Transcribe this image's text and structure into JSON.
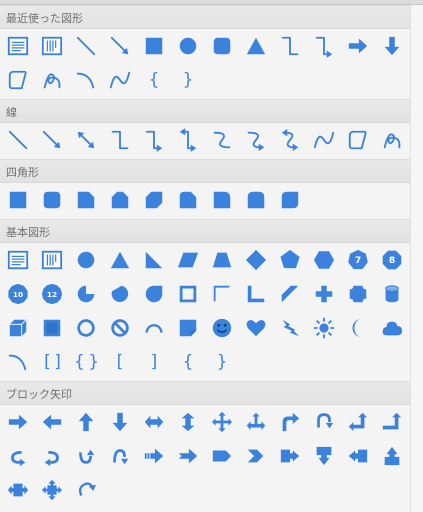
{
  "panel": {
    "accent": "#3a82dc",
    "sections": [
      {
        "title": "最近使った図形",
        "icons": [
          "text-box-icon",
          "vertical-text-box-icon",
          "line-icon",
          "arrow-line-icon",
          "rectangle-icon",
          "circle-icon",
          "rounded-rectangle-icon",
          "triangle-icon",
          "elbow-connector-icon",
          "elbow-arrow-connector-icon",
          "right-arrow-icon",
          "down-arrow-icon",
          "freeform-shape-icon",
          "scribble-icon",
          "arc-icon",
          "curve-icon",
          "left-brace-icon",
          "right-brace-icon"
        ]
      },
      {
        "title": "線",
        "icons": [
          "line-icon",
          "arrow-line-icon",
          "double-arrow-line-icon",
          "elbow-connector-icon",
          "elbow-arrow-connector-icon",
          "elbow-double-arrow-connector-icon",
          "curved-connector-icon",
          "curved-arrow-connector-icon",
          "curved-double-arrow-connector-icon",
          "curve-icon",
          "freeform-shape-icon",
          "scribble-icon"
        ]
      },
      {
        "title": "四角形",
        "icons": [
          "rectangle-icon",
          "rounded-rectangle-icon",
          "snip-single-corner-rectangle-icon",
          "snip-same-side-corner-rectangle-icon",
          "snip-diagonal-corner-rectangle-icon",
          "snip-round-single-corner-rectangle-icon",
          "round-single-corner-rectangle-icon",
          "round-same-side-corner-rectangle-icon",
          "round-diagonal-corner-rectangle-icon"
        ]
      },
      {
        "title": "基本図形",
        "icons": [
          "text-box-icon",
          "vertical-text-box-icon",
          "oval-icon",
          "isosceles-triangle-icon",
          "right-triangle-icon",
          "parallelogram-icon",
          "trapezoid-icon",
          "diamond-icon",
          "pentagon-icon",
          "hexagon-icon",
          "heptagon-icon",
          "octagon-icon",
          "decagon-icon",
          "dodecagon-icon",
          "pie-icon",
          "chord-icon",
          "teardrop-icon",
          "frame-icon",
          "half-frame-icon",
          "l-shape-icon",
          "diagonal-stripe-icon",
          "cross-icon",
          "plaque-icon",
          "can-icon",
          "cube-icon",
          "bevel-icon",
          "donut-icon",
          "no-symbol-icon",
          "block-arc-icon",
          "folded-corner-icon",
          "smiley-face-icon",
          "heart-icon",
          "lightning-bolt-icon",
          "sun-icon",
          "moon-icon",
          "cloud-icon",
          "arc-icon",
          "double-bracket-icon",
          "double-brace-icon",
          "left-bracket-icon",
          "right-bracket-icon",
          "left-brace-icon",
          "right-brace-icon"
        ],
        "badges": {
          "heptagon-icon": "7",
          "octagon-icon": "8",
          "decagon-icon": "10",
          "dodecagon-icon": "12"
        }
      },
      {
        "title": "ブロック矢印",
        "icons": [
          "right-arrow-icon",
          "left-arrow-icon",
          "up-arrow-icon",
          "down-arrow-icon",
          "left-right-arrow-icon",
          "up-down-arrow-icon",
          "quad-arrow-icon",
          "left-right-up-arrow-icon",
          "bent-arrow-icon",
          "u-turn-arrow-icon",
          "left-up-arrow-icon",
          "bent-up-arrow-icon",
          "curved-right-arrow-icon",
          "curved-left-arrow-icon",
          "curved-up-arrow-icon",
          "curved-down-arrow-icon",
          "striped-right-arrow-icon",
          "notched-right-arrow-icon",
          "pentagon-arrow-icon",
          "chevron-arrow-icon",
          "right-arrow-callout-icon",
          "down-arrow-callout-icon",
          "left-arrow-callout-icon",
          "up-arrow-callout-icon",
          "left-right-arrow-callout-icon",
          "quad-arrow-callout-icon",
          "circular-arrow-icon"
        ]
      }
    ]
  }
}
